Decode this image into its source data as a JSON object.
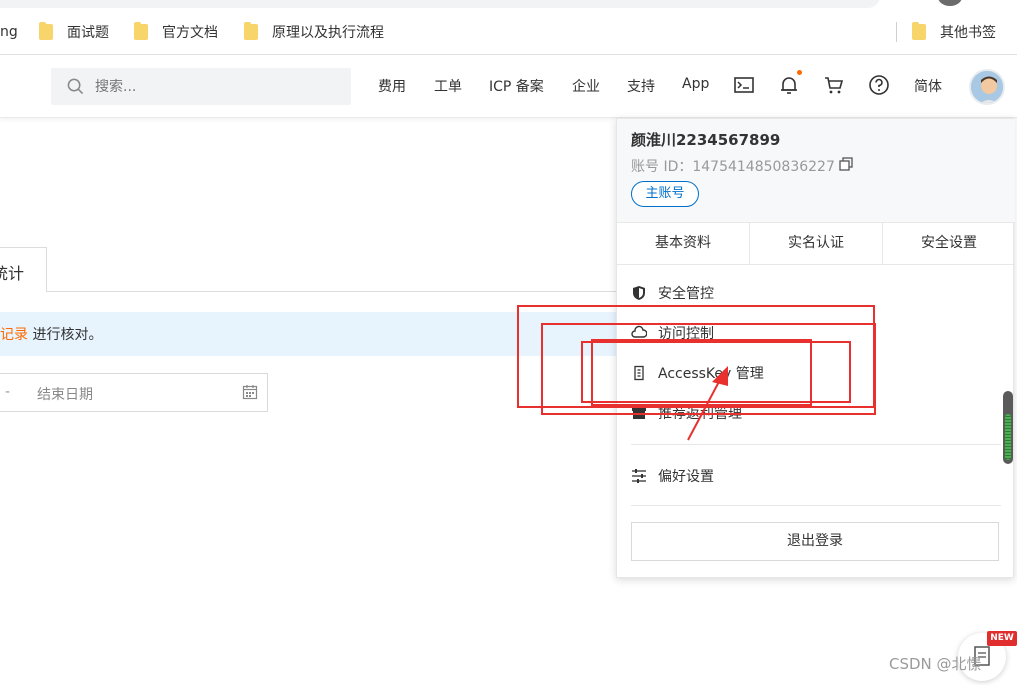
{
  "bookmarks": {
    "partial_left": "ng",
    "items": [
      {
        "label": "面试题"
      },
      {
        "label": "官方文档"
      },
      {
        "label": "原理以及执行流程"
      }
    ],
    "other": "其他书签"
  },
  "header": {
    "search_placeholder": "搜索...",
    "nav": [
      "费用",
      "工单",
      "ICP 备案",
      "企业",
      "支持",
      "App"
    ],
    "language": "简体"
  },
  "page": {
    "tab_partial": "统计",
    "notice_link": "记录",
    "notice_text": " 进行核对。",
    "date_dash": "-",
    "date_end_placeholder": "结束日期"
  },
  "dropdown": {
    "name": "颜淮川2234567899",
    "account_id": "账号 ID：1475414850836227",
    "badge": "主账号",
    "tabs": [
      "基本资料",
      "实名认证",
      "安全设置"
    ],
    "items": [
      {
        "label": "安全管控",
        "icon": "shield-icon"
      },
      {
        "label": "访问控制",
        "icon": "cloud-icon"
      },
      {
        "label": "AccessKey 管理",
        "icon": "key-icon"
      },
      {
        "label": "推荐返利管理",
        "icon": "gift-icon"
      },
      {
        "label": "偏好设置",
        "icon": "sliders-icon"
      }
    ],
    "logout": "退出登录"
  },
  "floating": {
    "new_badge": "NEW"
  },
  "watermark": "CSDN @北憬",
  "colors": {
    "accent_orange": "#ff6a00",
    "primary_blue": "#0070cc",
    "annotation_red": "#e8312e",
    "notice_bg": "#e8f4fd"
  }
}
